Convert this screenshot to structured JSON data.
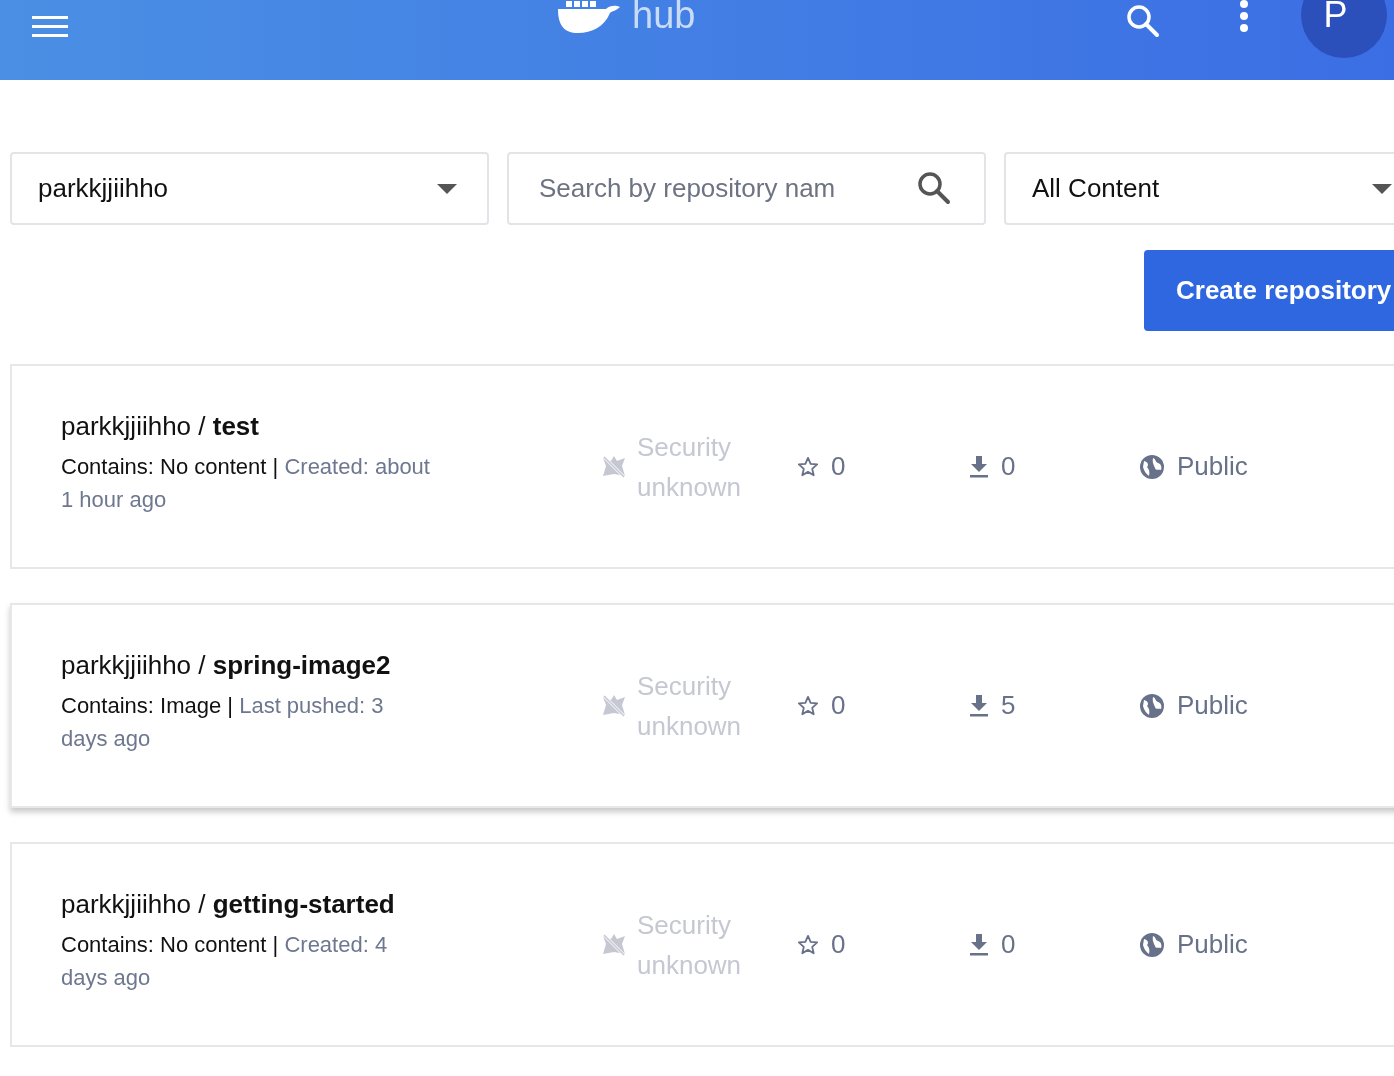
{
  "header": {
    "logo_text": "hub",
    "avatar_letter": "P"
  },
  "filters": {
    "namespace": "parkkjjiihho",
    "search": {
      "placeholder": "Search by repository nam"
    },
    "content": "All Content"
  },
  "create_button": "Create repository",
  "repositories": [
    {
      "title": "parkkjjiihho / **test**",
      "contains": "Contains: No content |",
      "meta": "Created: about 1 hour ago",
      "security": "Security unknown",
      "stars": "0",
      "pulls": "0",
      "visibility": "Public",
      "selected": false
    },
    {
      "title": "parkkjjiihho / **spring-image2**",
      "contains": "Contains: Image |",
      "meta": "Last pushed: 3 days ago",
      "security": "Security unknown",
      "stars": "0",
      "pulls": "5",
      "visibility": "Public",
      "selected": true
    },
    {
      "title": "parkkjjiihho / **getting-started**",
      "contains": "Contains: No content |",
      "meta": "Created: 4 days ago",
      "security": "Security unknown",
      "stars": "0",
      "pulls": "0",
      "visibility": "Public",
      "selected": false
    }
  ]
}
